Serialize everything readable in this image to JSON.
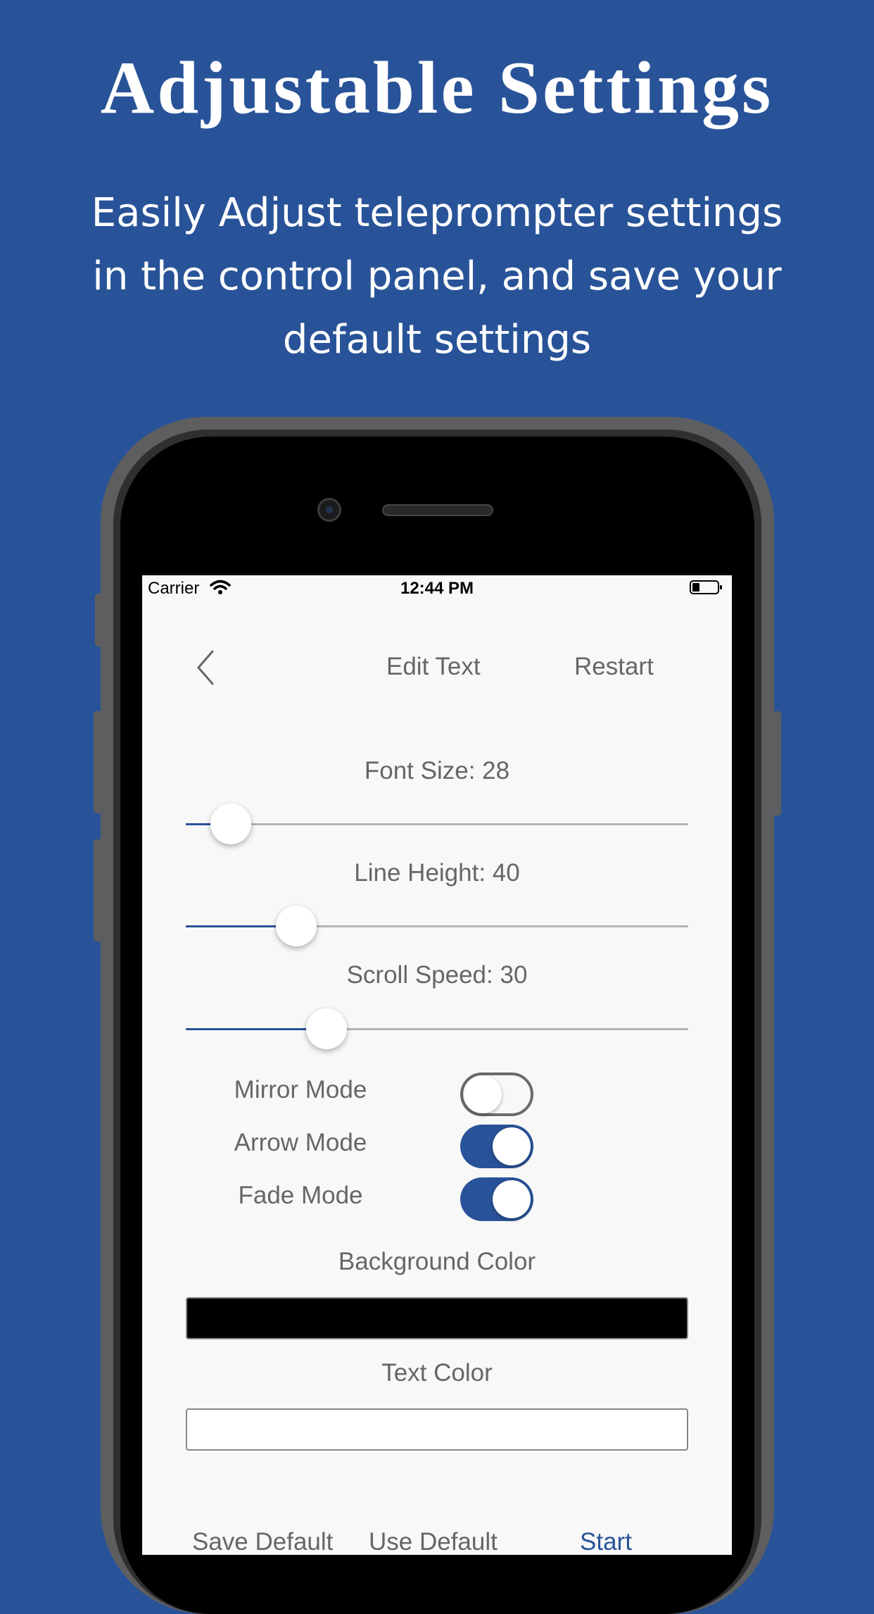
{
  "headline": "Adjustable Settings",
  "subtitle": "Easily Adjust teleprompter settings in the control panel, and save your default settings",
  "status_bar": {
    "carrier": "Carrier",
    "time": "12:44 PM",
    "wifi_icon": "wifi-icon",
    "battery_icon": "battery-icon"
  },
  "nav": {
    "back_icon": "chevron-left-icon",
    "edit_text": "Edit Text",
    "restart": "Restart"
  },
  "sliders": [
    {
      "label": "Font Size: 28",
      "value": 28,
      "fraction": 0.09
    },
    {
      "label": "Line Height: 40",
      "value": 40,
      "fraction": 0.22
    },
    {
      "label": "Scroll Speed: 30",
      "value": 30,
      "fraction": 0.28
    }
  ],
  "toggles": [
    {
      "label": "Mirror Mode",
      "on": false
    },
    {
      "label": "Arrow Mode",
      "on": true
    },
    {
      "label": "Fade Mode",
      "on": true
    }
  ],
  "background_color": {
    "label": "Background Color",
    "value": "#000000"
  },
  "text_color": {
    "label": "Text Color",
    "value": "#ffffff"
  },
  "bottom": {
    "save_default": "Save Default",
    "use_default": "Use Default",
    "start": "Start"
  },
  "colors": {
    "brand_blue": "#295398",
    "screen_bg": "#f8f8f8",
    "label_gray": "#666666"
  }
}
